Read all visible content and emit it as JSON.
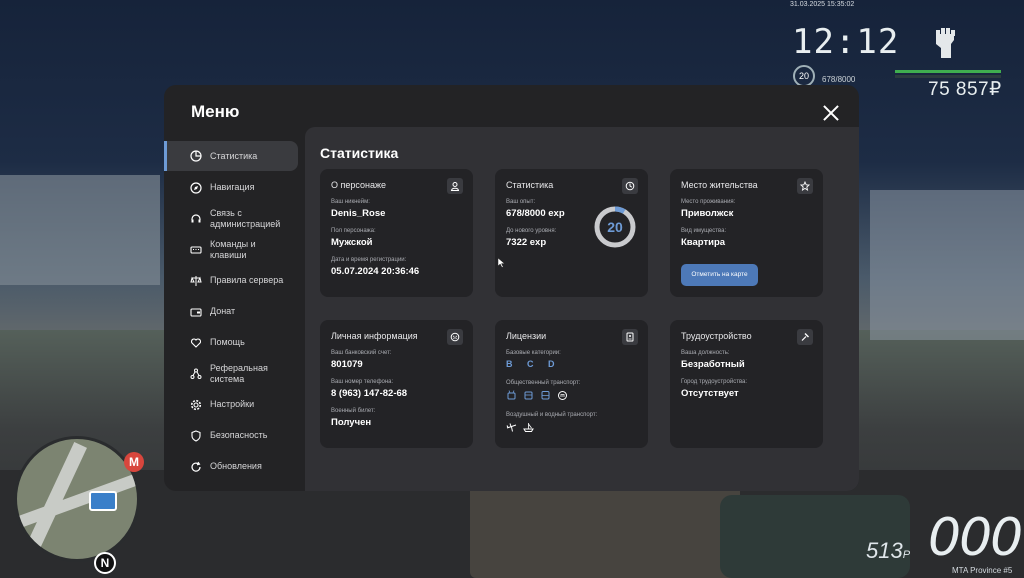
{
  "hud": {
    "datetime": "31.03.2025 15:35:02",
    "clock": "12:12",
    "level": "20",
    "exp": "678/8000",
    "money": "75 857₽",
    "speed": "513",
    "speed_unit": "Р",
    "odometer": "000",
    "server": "MTA Province #5",
    "minimap_metro": "M",
    "minimap_north": "N"
  },
  "menu": {
    "title": "Меню",
    "sidebar": [
      {
        "label": "Статистика",
        "icon": "pie-chart-icon",
        "active": true
      },
      {
        "label": "Навигация",
        "icon": "compass-icon"
      },
      {
        "label": "Связь с администрацией",
        "icon": "headset-icon"
      },
      {
        "label": "Команды и клавиши",
        "icon": "keyboard-icon"
      },
      {
        "label": "Правила сервера",
        "icon": "scales-icon"
      },
      {
        "label": "Донат",
        "icon": "wallet-icon"
      },
      {
        "label": "Помощь",
        "icon": "heart-hand-icon"
      },
      {
        "label": "Реферальная система",
        "icon": "network-icon"
      },
      {
        "label": "Настройки",
        "icon": "gear-icon"
      },
      {
        "label": "Безопасность",
        "icon": "shield-icon"
      },
      {
        "label": "Обновления",
        "icon": "refresh-icon"
      }
    ]
  },
  "content": {
    "title": "Статистика",
    "character": {
      "title": "О персонаже",
      "nick_label": "Ваш никнейм:",
      "nick": "Denis_Rose",
      "gender_label": "Пол персонажа:",
      "gender": "Мужской",
      "reg_label": "Дата и время регистрации:",
      "reg": "05.07.2024 20:36:46"
    },
    "stats": {
      "title": "Статистика",
      "exp_label": "Ваш опыт:",
      "exp": "678/8000 exp",
      "next_label": "До нового уровня:",
      "next": "7322 exp",
      "level": "20",
      "progress": 0.085,
      "accent_color": "#6e9bd6"
    },
    "residence": {
      "title": "Место жительства",
      "place_label": "Место проживания:",
      "place": "Приволжск",
      "type_label": "Вид имущества:",
      "type": "Квартира",
      "button": "Отметить на карте"
    },
    "personal": {
      "title": "Личная информация",
      "bank_label": "Ваш банковский счет:",
      "bank": "801079",
      "phone_label": "Ваш номер телефона:",
      "phone": "8 (963) 147-82-68",
      "military_label": "Военный билет:",
      "military": "Получен"
    },
    "licenses": {
      "title": "Лицензии",
      "base_label": "Базовые категории:",
      "base": "B C D",
      "public_label": "Общественный транспорт:",
      "air_label": "Воздушный и водный транспорт:"
    },
    "employment": {
      "title": "Трудоустройство",
      "position_label": "Ваша должность:",
      "position": "Безработный",
      "city_label": "Город трудоустройства:",
      "city": "Отсутствует"
    }
  }
}
